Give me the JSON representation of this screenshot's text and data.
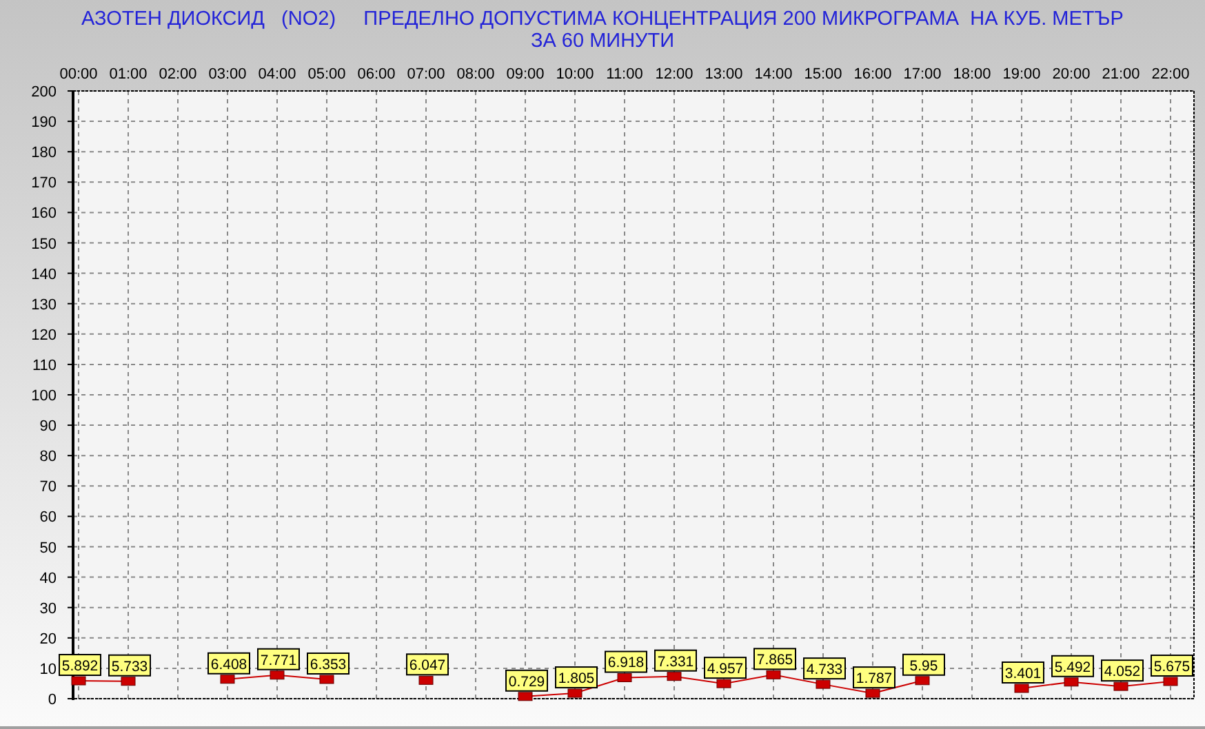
{
  "header": {
    "title": "АЗОТЕН ДИОКСИД   (NO2)     ПРЕДЕЛНО ДОПУСТИМА КОНЦЕНТРАЦИЯ 200 МИКРОГРАМА  НА КУБ. МЕТЪР",
    "subtitle": "ЗА 60 МИНУТИ"
  },
  "chart_data": {
    "type": "line",
    "categories": [
      "00:00",
      "01:00",
      "02:00",
      "03:00",
      "04:00",
      "05:00",
      "06:00",
      "07:00",
      "08:00",
      "09:00",
      "10:00",
      "11:00",
      "12:00",
      "13:00",
      "14:00",
      "15:00",
      "16:00",
      "17:00",
      "18:00",
      "19:00",
      "20:00",
      "21:00",
      "22:00"
    ],
    "series": [
      {
        "color": "#cc0000",
        "marker": "square",
        "values": [
          5.892,
          5.733,
          null,
          6.408,
          7.771,
          6.353,
          null,
          6.047,
          null,
          0.729,
          1.805,
          6.918,
          7.331,
          4.957,
          7.865,
          4.733,
          1.787,
          5.95,
          null,
          3.401,
          5.492,
          4.052,
          5.675
        ]
      }
    ],
    "ylim": [
      0,
      200
    ],
    "grid": true,
    "yticks": [
      0,
      10,
      20,
      30,
      40,
      50,
      60,
      70,
      80,
      90,
      100,
      110,
      120,
      130,
      140,
      150,
      160,
      170,
      180,
      190,
      200
    ],
    "data_labels": true
  }
}
